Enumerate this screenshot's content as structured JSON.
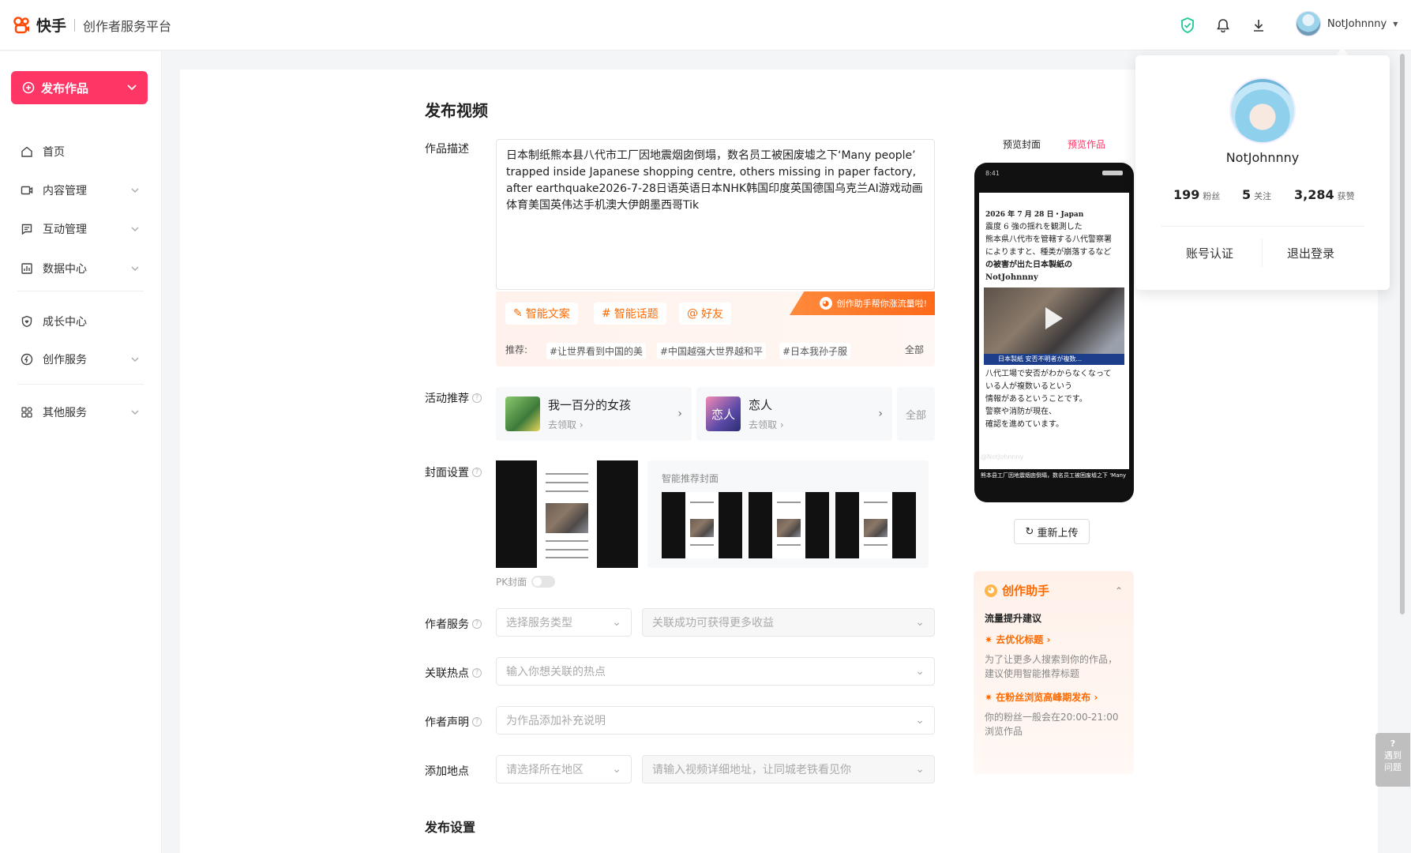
{
  "header": {
    "brand": "快手",
    "platform": "创作者服务平台",
    "username": "NotJohnnny"
  },
  "sidebar": {
    "publish_label": "发布作品",
    "items": [
      {
        "label": "首页",
        "icon": "home-icon"
      },
      {
        "label": "内容管理",
        "icon": "video-icon"
      },
      {
        "label": "互动管理",
        "icon": "message-icon"
      },
      {
        "label": "数据中心",
        "icon": "chart-icon"
      },
      {
        "label": "成长中心",
        "icon": "shield-heart-icon"
      },
      {
        "label": "创作服务",
        "icon": "lightning-icon"
      },
      {
        "label": "其他服务",
        "icon": "apps-icon"
      }
    ]
  },
  "main": {
    "page_title": "发布视频",
    "desc_label": "作品描述",
    "description": "日本制纸熊本县八代市工厂因地震烟囱倒塌，数名员工被困废墟之下‘Many people’ trapped inside Japanese shopping centre, others missing in paper factory, after earthquake2026-7-28日语英语日本NHK韩国印度英国德国乌克兰AI游戏动画体育美国英伟达手机澳大伊朗墨西哥Tik",
    "ai": {
      "smart_copy": "智能文案",
      "smart_topic": "智能话题",
      "friends": "好友",
      "helper_tag": "创作助手帮你涨流量啦!",
      "recommend_label": "推荐:",
      "tags": [
        "#让世界看到中国的美",
        "#中国越强大世界越和平",
        "#日本我孙子服"
      ],
      "all": "全部"
    },
    "activity_label": "活动推荐",
    "activities": [
      {
        "title": "我一百分的女孩",
        "sub": "去领取"
      },
      {
        "title": "恋人",
        "sub": "去领取",
        "thumb_text": "恋人"
      }
    ],
    "activity_all": "全部",
    "cover_label": "封面设置",
    "smart_cover_label": "智能推荐封面",
    "pk_cover": "PK封面",
    "author_service_label": "作者服务",
    "service_type_placeholder": "选择服务类型",
    "service_link_placeholder": "关联成功可获得更多收益",
    "hot_label": "关联热点",
    "hot_placeholder": "输入你想关联的热点",
    "statement_label": "作者声明",
    "statement_placeholder": "为作品添加补充说明",
    "location_label": "添加地点",
    "region_placeholder": "请选择所在地区",
    "address_placeholder": "请输入视频详细地址，让同城老铁看见你",
    "publish_settings_label": "发布设置"
  },
  "preview": {
    "tab_cover": "预览封面",
    "tab_work": "预览作品",
    "status_time": "8:41",
    "screen_lines_top": [
      "2026 年 7 月 28 日・Japan",
      "震度 6 強の揺れを観測した",
      "熊本県八代市を管轄する八代警察署",
      "によりますと、種类が崩落するなど",
      "の被害が出た日本製紙の NotJohnnny"
    ],
    "news_banner": "日本製紙 安否不明者が複数...",
    "screen_lines_bottom": [
      "八代工場で安否がわからなくなって",
      "いる人が複数いるという",
      "情報があるということです。",
      "警察や消防が現在、",
      "確認を進めています。"
    ],
    "caption_user": "@NotJohnnny",
    "caption_text": "熊本县工厂因地震烟囱倒塌，数名员工被困废墟之下 'Many people'...展开",
    "reupload": "重新上传"
  },
  "assistant": {
    "title": "创作助手",
    "subtitle": "流量提升建议",
    "tip1_title": "去优化标题",
    "tip1_text": "为了让更多人搜索到你的作品，建议使用智能推荐标题",
    "tip2_title": "在粉丝浏览高峰期发布",
    "tip2_text": "你的粉丝一般会在20:00-21:00浏览作品"
  },
  "popup": {
    "name": "NotJohnnny",
    "fans_count": "199",
    "fans_label": "粉丝",
    "follow_count": "5",
    "follow_label": "关注",
    "likes_count": "3,284",
    "likes_label": "获赞",
    "verify": "账号认证",
    "logout": "退出登录"
  },
  "help": {
    "label": "遇到问题"
  },
  "colors": {
    "accent": "#fe3666",
    "orange": "#ff6a00",
    "brand_logo": "#ff4906"
  }
}
